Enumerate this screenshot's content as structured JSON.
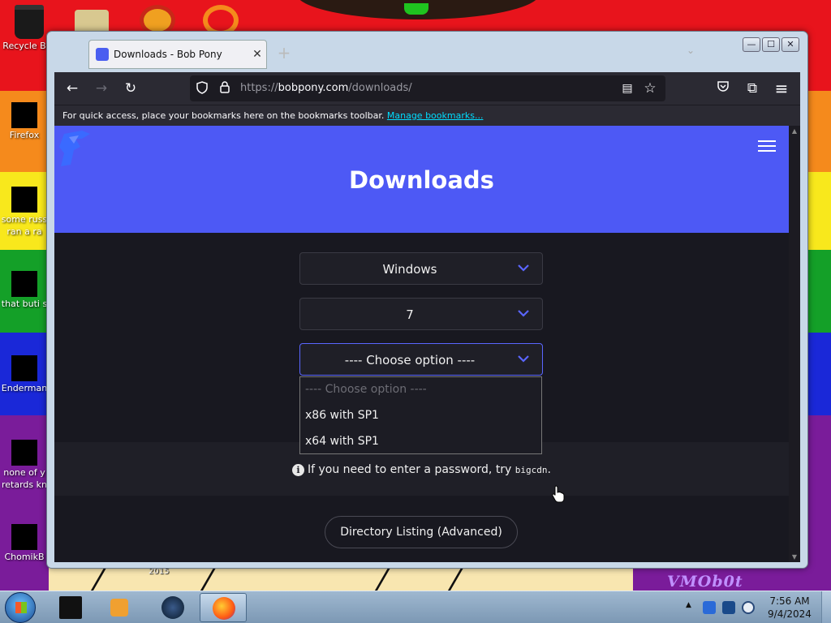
{
  "desktop": {
    "icons": [
      {
        "label": "Recycle B"
      },
      {
        "label": "Firefox"
      },
      {
        "label": "some russ"
      },
      {
        "label": "ran a ra"
      },
      {
        "label": "that buti s"
      },
      {
        "label": "Enderman"
      },
      {
        "label": "none of y"
      },
      {
        "label": "retards kn"
      },
      {
        "label": "ChomikB"
      }
    ],
    "year_label": "2015",
    "wallpaper_text": "VMOb0t"
  },
  "window": {
    "tab_title": "Downloads - Bob Pony",
    "tab_close": "✕",
    "new_tab": "+",
    "list_tabs": "⌄",
    "buttons": {
      "minimize": "—",
      "maximize": "☐",
      "close": "✕"
    }
  },
  "toolbar": {
    "back": "←",
    "forward": "→",
    "reload": "↻",
    "url_prefix": "https://",
    "url_domain": "bobpony.com",
    "url_path": "/downloads/",
    "reader": "▤",
    "bookmark": "☆",
    "pocket": "◡",
    "extensions": "⧉",
    "menu": "≡"
  },
  "bookmarks_bar": {
    "text": "For quick access, place your bookmarks here on the bookmarks toolbar.",
    "link": "Manage bookmarks..."
  },
  "page": {
    "title": "Downloads",
    "select_os": "Windows",
    "select_version": "7",
    "select_option": "---- Choose option ----",
    "dropdown_options": [
      {
        "label": "---- Choose option ----"
      },
      {
        "label": "x86 with SP1"
      },
      {
        "label": "x64 with SP1"
      }
    ],
    "info_icon": "i",
    "info_text": "If you need to enter a password, try ",
    "info_code": "bigcdn",
    "info_end": ".",
    "directory_button": "Directory Listing (Advanced)"
  },
  "taskbar": {
    "clock_time": "7:56 AM",
    "clock_date": "9/4/2024",
    "tray_arrow": "▲"
  },
  "colors": {
    "hero": "#4d59f5",
    "link": "#00ddff",
    "chevron": "#5a66ff"
  }
}
